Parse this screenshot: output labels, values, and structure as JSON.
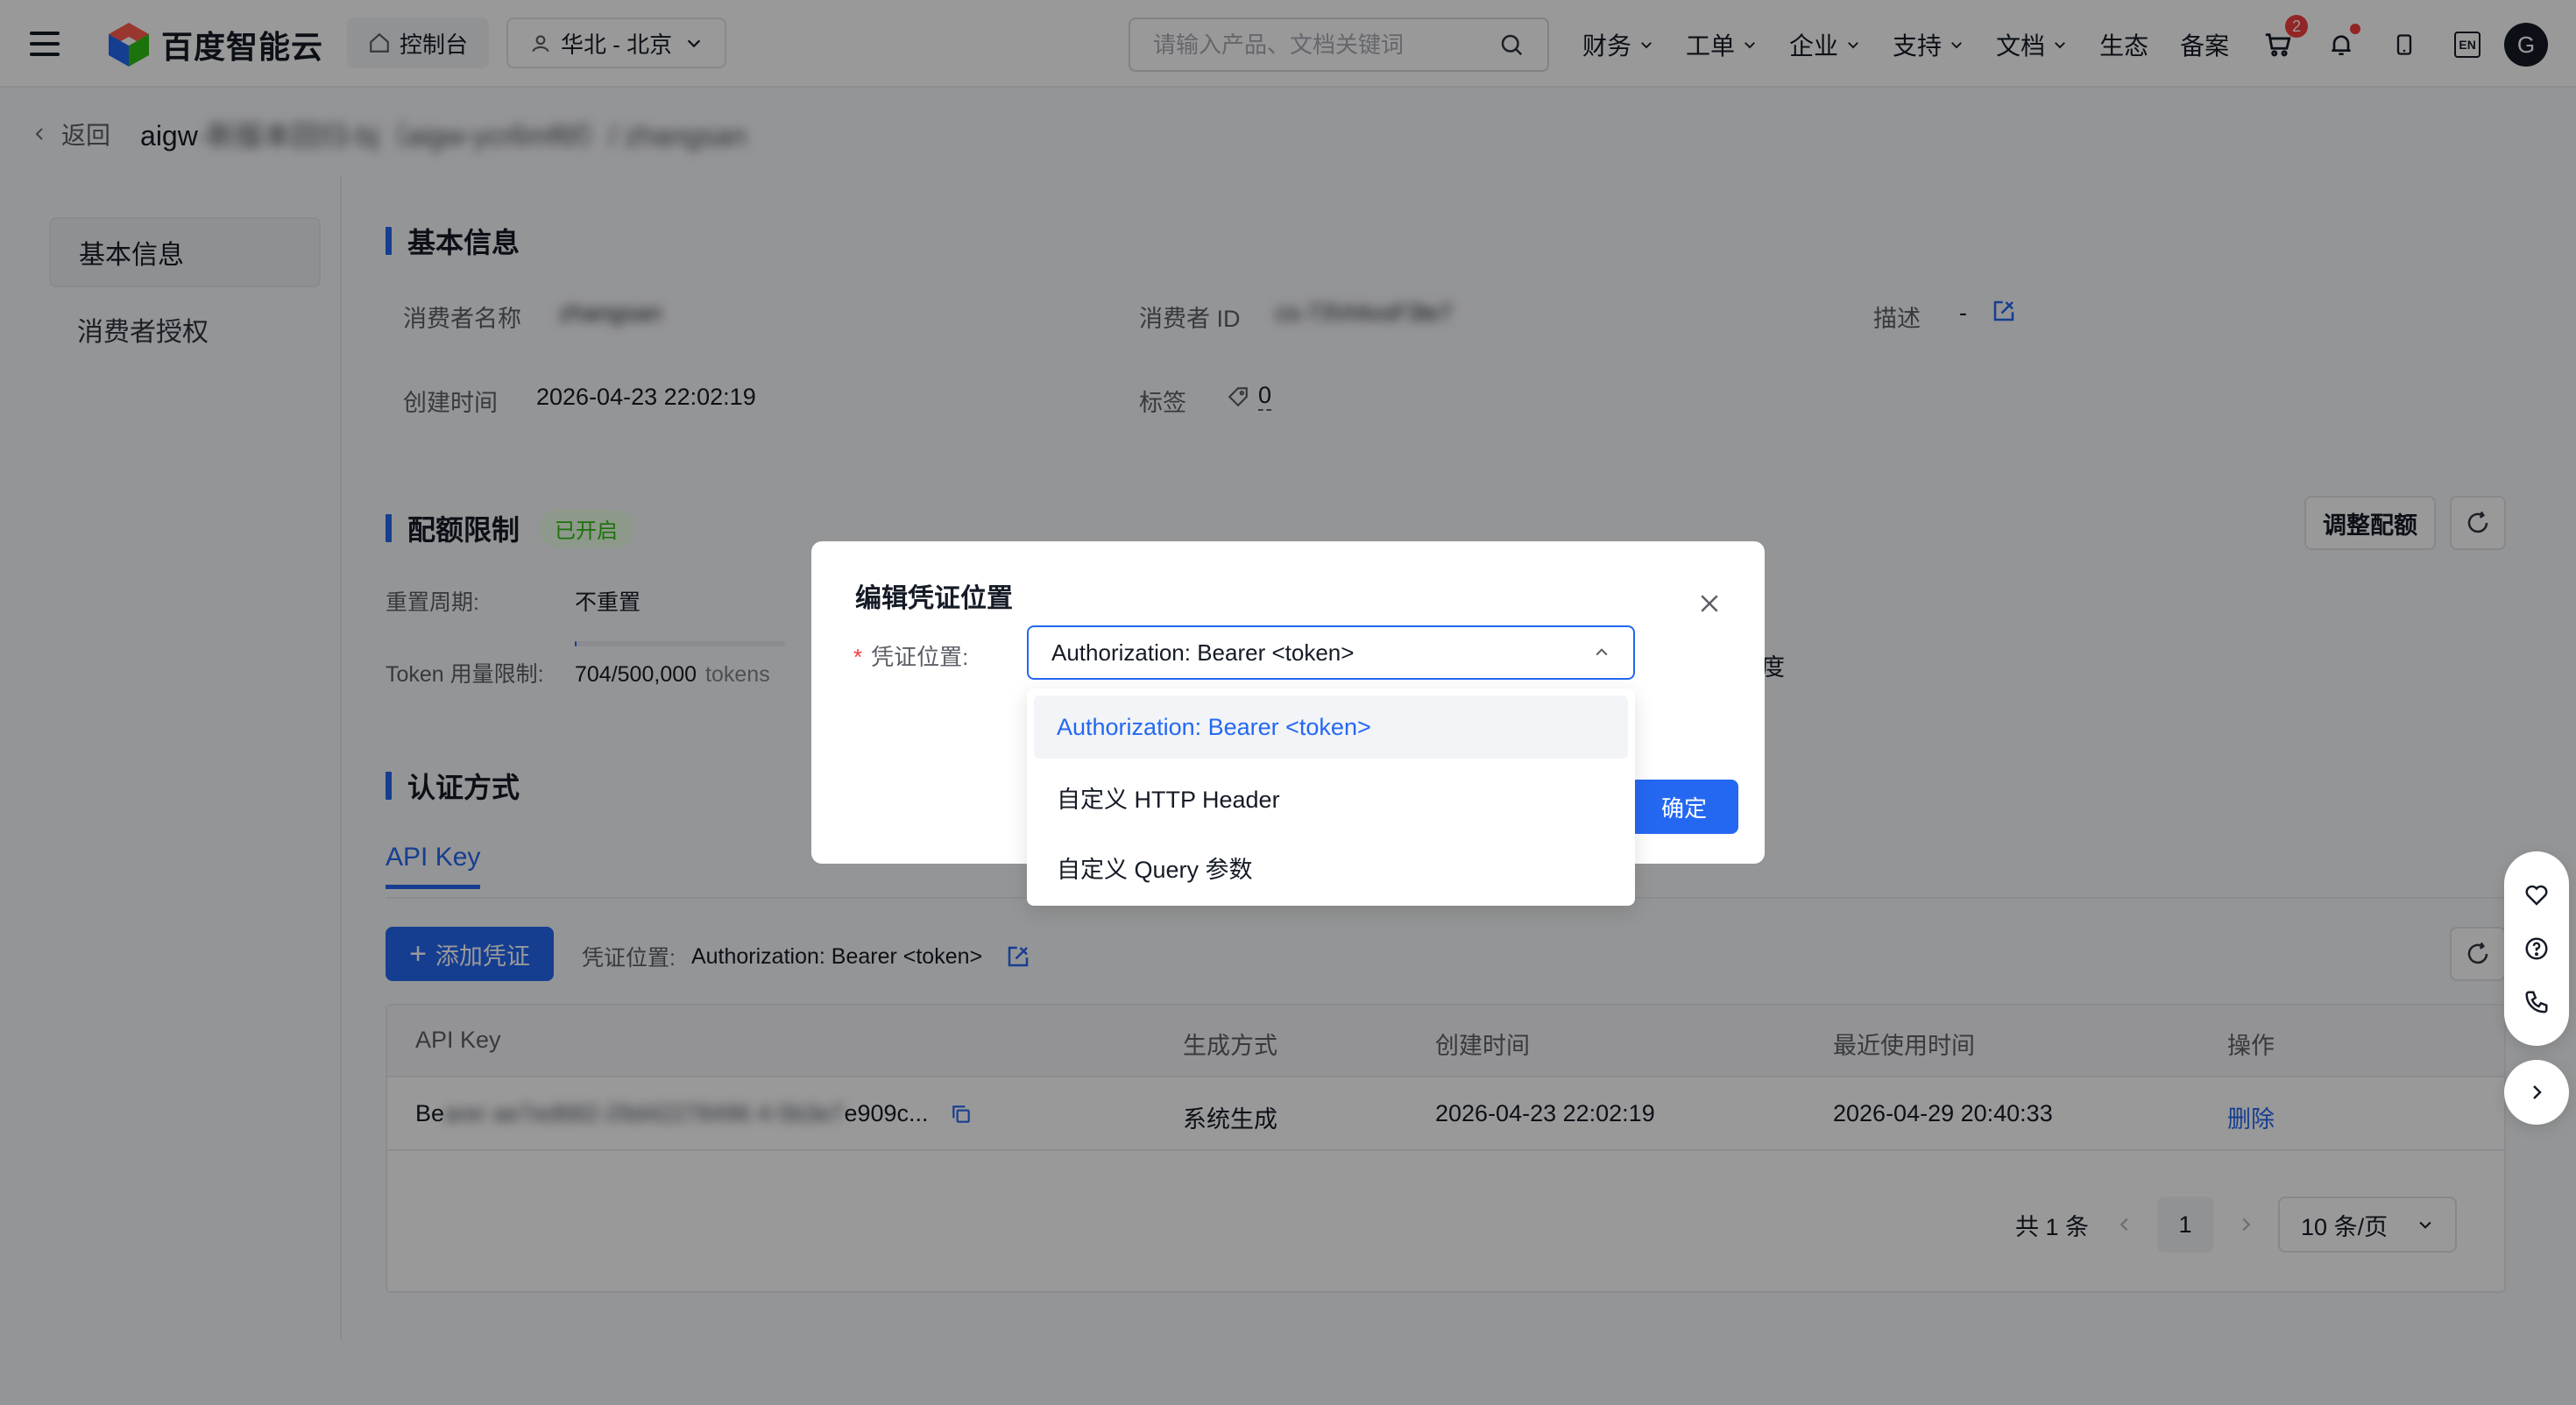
{
  "topnav": {
    "logo_text": "百度智能云",
    "console_label": "控制台",
    "region_label": "华北 - 北京",
    "search_placeholder": "请输入产品、文档关键词",
    "menu": [
      {
        "label": "财务",
        "has_dropdown": true
      },
      {
        "label": "工单",
        "has_dropdown": true
      },
      {
        "label": "企业",
        "has_dropdown": true
      },
      {
        "label": "支持",
        "has_dropdown": true
      },
      {
        "label": "文档",
        "has_dropdown": true
      },
      {
        "label": "生态",
        "has_dropdown": false
      },
      {
        "label": "备案",
        "has_dropdown": false
      }
    ],
    "cart_badge": "2",
    "lang_label": "EN",
    "avatar_letter": "G"
  },
  "breadcrumb": {
    "back_label": "返回",
    "title_prefix": "aigw",
    "title_blurred": "-新版本回归-bj（aigw-ycr6mf6f）/ zhangsan"
  },
  "sidenav": {
    "items": [
      {
        "label": "基本信息",
        "active": true
      },
      {
        "label": "消费者授权",
        "active": false
      }
    ]
  },
  "basic_info": {
    "title": "基本信息",
    "consumer_name_label": "消费者名称",
    "consumer_name_value": "zhangsan",
    "consumer_id_label": "消费者 ID",
    "consumer_id_value": "cs-73Vt4xsF3le7",
    "desc_label": "描述",
    "desc_value": "-",
    "created_label": "创建时间",
    "created_value": "2026-04-23 22:02:19",
    "tags_label": "标签",
    "tags_count": "0"
  },
  "quota": {
    "title": "配额限制",
    "status_tag": "已开启",
    "reset_label": "重置周期:",
    "reset_value": "不重置",
    "token_label": "Token 用量限制:",
    "token_used": "704/500,000",
    "token_unit": "tokens",
    "token_fraction": 0.0014,
    "adjust_button": "调整配额",
    "partial_right_text": "度"
  },
  "auth": {
    "title": "认证方式",
    "tab_label": "API Key",
    "add_button": "添加凭证",
    "location_label": "凭证位置:",
    "location_value": "Authorization: Bearer <token>",
    "columns": [
      "API Key",
      "生成方式",
      "创建时间",
      "最近使用时间",
      "操作"
    ],
    "rows": [
      {
        "key_prefix": "Be",
        "key_blurred": "arer ae7ed682-29d42278496 4-5b3e7",
        "key_suffix": "e909c...",
        "gen": "系统生成",
        "created": "2026-04-23 22:02:19",
        "last_used": "2026-04-29 20:40:33",
        "action": "删除"
      }
    ],
    "pager_total": "共 1 条",
    "pager_page": "1",
    "pager_size": "10 条/页"
  },
  "modal": {
    "title": "编辑凭证位置",
    "field_label": "凭证位置:",
    "required_mark": "*",
    "selected_value": "Authorization: Bearer <token>",
    "ok_button": "确定",
    "options": [
      {
        "label": "Authorization: Bearer <token>",
        "selected": true
      },
      {
        "label": "自定义 HTTP Header",
        "selected": false
      },
      {
        "label": "自定义 Query 参数",
        "selected": false
      }
    ]
  },
  "colors": {
    "primary": "#2468f2",
    "success": "#30bf13",
    "danger": "#f33e3e"
  }
}
